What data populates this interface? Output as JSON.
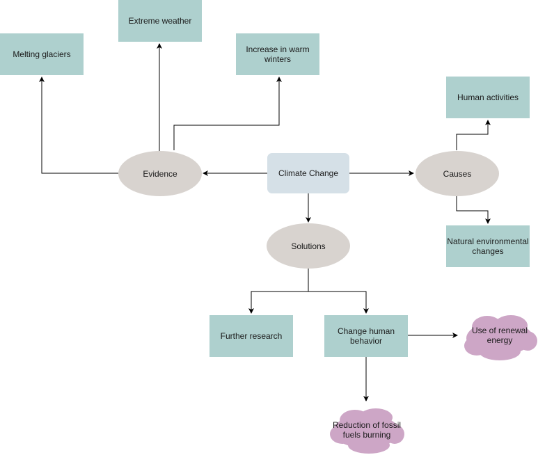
{
  "diagram": {
    "title": "Climate Change",
    "colors": {
      "box": "#aed0ce",
      "center": "#d5e0e7",
      "ellipse": "#d8d3cf",
      "cloud": "#cda6c6",
      "line": "#000000",
      "gray_line": "#808080"
    },
    "nodes": {
      "climate_change": "Climate Change",
      "evidence": "Evidence",
      "causes": "Causes",
      "solutions": "Solutions",
      "melting_glaciers": "Melting glaciers",
      "extreme_weather": "Extreme weather",
      "warm_winters": "Increase in warm winters",
      "human_activities": "Human activities",
      "natural_changes": "Natural environmental changes",
      "further_research": "Further research",
      "change_behavior": "Change human behavior",
      "renewal_energy": "Use of renewal energy",
      "reduce_fossil": "Reduction of fossil fuels burning"
    },
    "edges": [
      {
        "from": "Climate Change",
        "to": "Evidence"
      },
      {
        "from": "Climate Change",
        "to": "Causes"
      },
      {
        "from": "Climate Change",
        "to": "Solutions"
      },
      {
        "from": "Evidence",
        "to": "Melting glaciers"
      },
      {
        "from": "Evidence",
        "to": "Extreme weather"
      },
      {
        "from": "Evidence",
        "to": "Increase in warm winters"
      },
      {
        "from": "Causes",
        "to": "Human activities"
      },
      {
        "from": "Causes",
        "to": "Natural environmental changes"
      },
      {
        "from": "Solutions",
        "to": "Further research"
      },
      {
        "from": "Solutions",
        "to": "Change human behavior"
      },
      {
        "from": "Change human behavior",
        "to": "Use of renewal energy"
      },
      {
        "from": "Change human behavior",
        "to": "Reduction of fossil fuels burning"
      }
    ]
  }
}
